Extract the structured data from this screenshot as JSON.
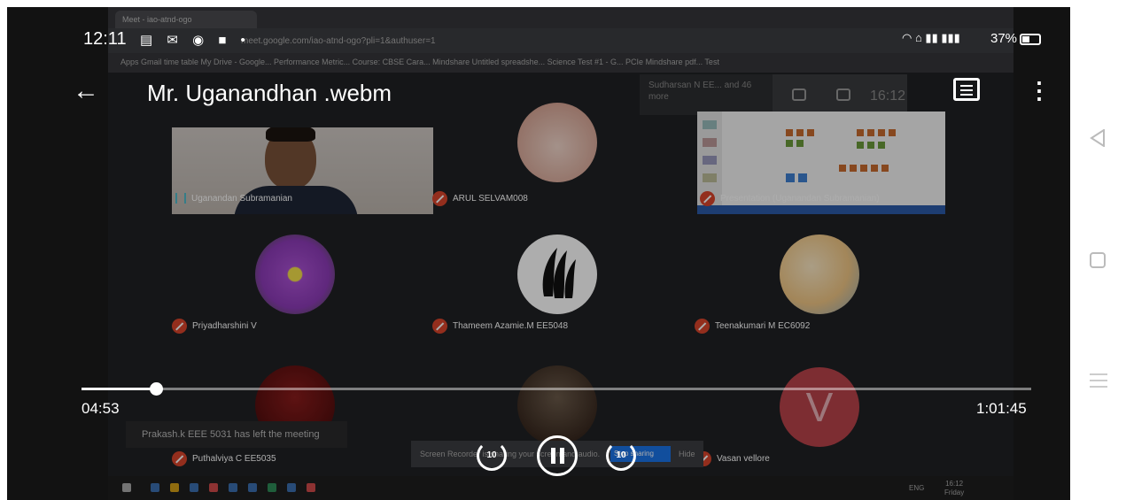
{
  "status_bar": {
    "time": "12:11",
    "battery": "37%"
  },
  "player": {
    "title": "Mr. Uganandhan .webm",
    "current_time": "04:53",
    "total_time": "1:01:45",
    "progress": 0.078,
    "rewind_label": "10",
    "forward_label": "10"
  },
  "recording": {
    "browser_tab": "Meet - iao-atnd-ogo",
    "url": "meet.google.com/iao-atnd-ogo?pli=1&authuser=1",
    "bookmarks": "Apps   Gmail   time table   My Drive - Google...   Performance Metric...   Course: CBSE Cara...   Mindshare   Untitled spreadshe...   Science Test #1 - G...   PCIe Mindshare pdf...   Test",
    "banner_text": "Sudharsan N EE... and 46 more",
    "meet_clock": "16:12",
    "toast": "Prakash.k EEE 5031 has left the meeting",
    "screen_bar": "Screen Recorder is sharing your screen and audio.",
    "stop_sharing": "Stop sharing",
    "hide": "Hide",
    "taskbar_lang": "ENG",
    "taskbar_time": "16:12",
    "taskbar_day": "Friday",
    "participants": [
      {
        "name": "Uganandan Subramanian",
        "muted": false
      },
      {
        "name": "ARUL SELVAM008",
        "muted": true
      },
      {
        "name": "Presentation (Uganandan Subramanian)",
        "muted": true
      },
      {
        "name": "Priyadharshini V",
        "muted": true
      },
      {
        "name": "Thameem Azamie.M EE5048",
        "muted": true
      },
      {
        "name": "Teenakumari M EC6092",
        "muted": true
      },
      {
        "name": "Puthalviya C EE5035",
        "muted": true
      },
      {
        "name": "Vasan vellore",
        "muted": true
      }
    ],
    "avatar_letter": "V"
  },
  "colors": {
    "mute_badge": "#d9452b",
    "avatar_v": "#c5454c",
    "meet_bg": "#202124"
  }
}
